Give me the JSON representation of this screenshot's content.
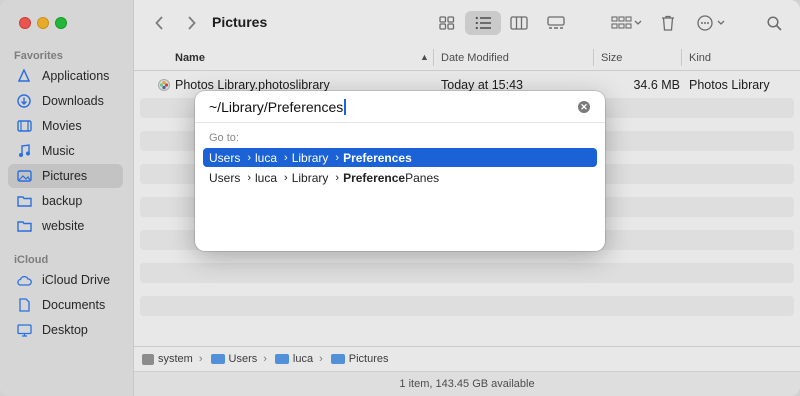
{
  "window": {
    "title": "Pictures"
  },
  "sidebar": {
    "sections": [
      {
        "heading": "Favorites",
        "items": [
          {
            "label": "Applications",
            "icon": "applications-icon",
            "active": false
          },
          {
            "label": "Downloads",
            "icon": "downloads-icon",
            "active": false
          },
          {
            "label": "Movies",
            "icon": "movies-icon",
            "active": false
          },
          {
            "label": "Music",
            "icon": "music-icon",
            "active": false
          },
          {
            "label": "Pictures",
            "icon": "pictures-icon",
            "active": true
          },
          {
            "label": "backup",
            "icon": "folder-icon",
            "active": false
          },
          {
            "label": "website",
            "icon": "folder-icon",
            "active": false
          }
        ]
      },
      {
        "heading": "iCloud",
        "items": [
          {
            "label": "iCloud Drive",
            "icon": "icloud-icon",
            "active": false
          },
          {
            "label": "Documents",
            "icon": "document-icon",
            "active": false
          },
          {
            "label": "Desktop",
            "icon": "desktop-icon",
            "active": false
          }
        ]
      }
    ]
  },
  "columns": {
    "name": "Name",
    "date": "Date Modified",
    "size": "Size",
    "kind": "Kind"
  },
  "files": [
    {
      "name": "Photos Library.photoslibrary",
      "date": "Today at 15:43",
      "size": "34.6 MB",
      "kind": "Photos Library"
    }
  ],
  "pathbar": [
    "system",
    "Users",
    "luca",
    "Pictures"
  ],
  "status": "1 item, 143.45 GB available",
  "goto": {
    "input_value": "~/Library/Preferences",
    "label": "Go to:",
    "suggestions": [
      {
        "parts": [
          "Users",
          "luca",
          "Library"
        ],
        "last_bold": "Preferences",
        "last_rest": "",
        "selected": true
      },
      {
        "parts": [
          "Users",
          "luca",
          "Library"
        ],
        "last_bold": "Preference",
        "last_rest": "Panes",
        "selected": false
      }
    ]
  },
  "colors": {
    "accent": "#1a62d6",
    "folder": "#5aa0f0"
  }
}
